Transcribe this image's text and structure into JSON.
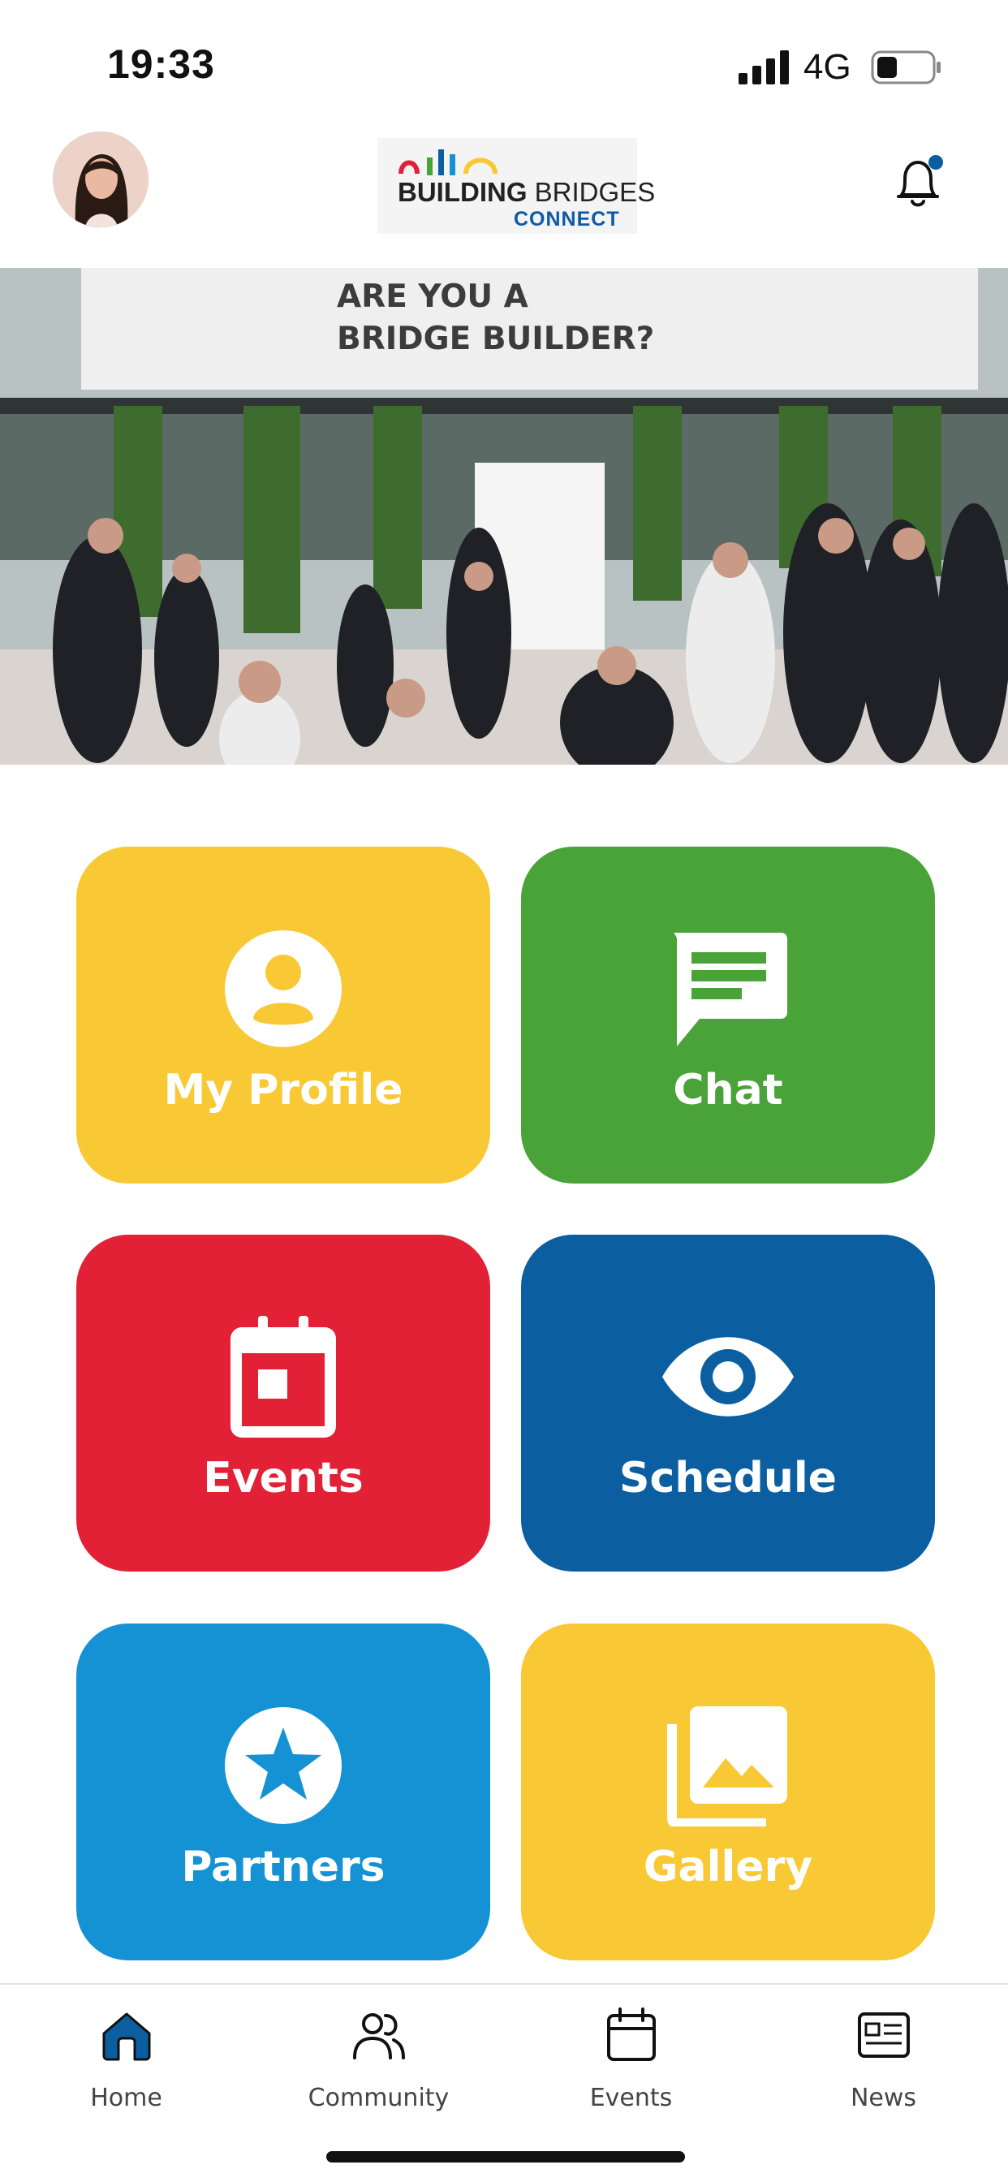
{
  "status_bar": {
    "time": "19:33",
    "network": "4G"
  },
  "header": {
    "logo_line1_bold": "BUILDING",
    "logo_line1_rest": "BRIDGES",
    "logo_line2": "CONNECT"
  },
  "hero": {
    "banner_line1": "ARE YOU A",
    "banner_line2": "BRIDGE BUILDER?"
  },
  "tiles": [
    {
      "label": "My Profile",
      "color": "#f9c935",
      "icon": "person-icon"
    },
    {
      "label": "Chat",
      "color": "#4aa338",
      "icon": "chat-icon"
    },
    {
      "label": "Events",
      "color": "#e22136",
      "icon": "calendar-icon"
    },
    {
      "label": "Schedule",
      "color": "#0b5fa0",
      "icon": "eye-icon"
    },
    {
      "label": "Partners",
      "color": "#1592d3",
      "icon": "star-icon"
    },
    {
      "label": "Gallery",
      "color": "#f9c935",
      "icon": "gallery-icon"
    }
  ],
  "tab_bar": {
    "active_color": "#0b5fa0",
    "items": [
      {
        "label": "Home",
        "icon": "home-icon",
        "active": true
      },
      {
        "label": "Community",
        "icon": "community-icon",
        "active": false
      },
      {
        "label": "Events",
        "icon": "calendar-icon",
        "active": false
      },
      {
        "label": "News",
        "icon": "news-icon",
        "active": false
      }
    ]
  }
}
